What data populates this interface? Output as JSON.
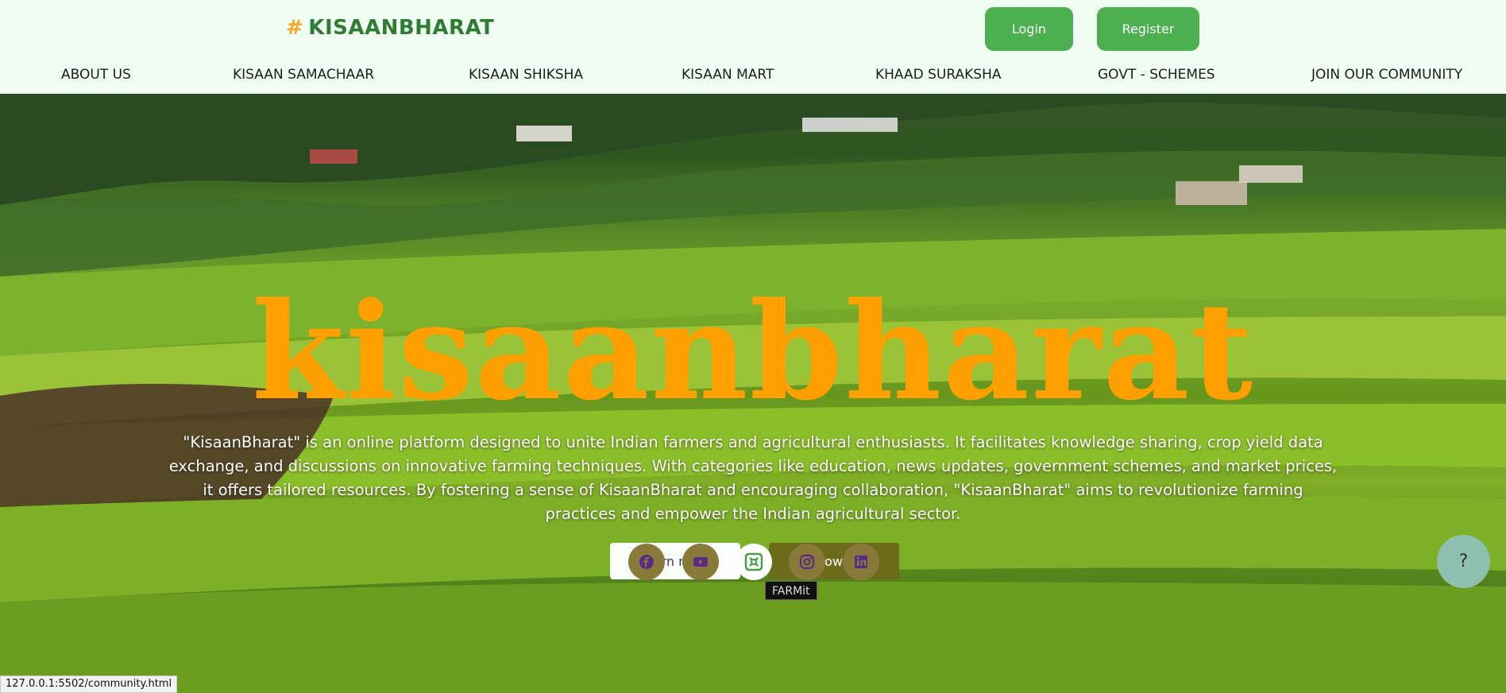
{
  "header": {
    "logo_hash": "#",
    "logo_text": "KISAANBHARAT",
    "login_label": "Login",
    "register_label": "Register"
  },
  "nav": {
    "items": [
      {
        "label": "ABOUT US"
      },
      {
        "label": "KISAAN SAMACHAAR"
      },
      {
        "label": "KISAAN SHIKSHA"
      },
      {
        "label": "KISAAN MART"
      },
      {
        "label": "KHAAD SURAKSHA"
      },
      {
        "label": "GOVT - SCHEMES"
      },
      {
        "label": "JOIN OUR COMMUNITY"
      }
    ]
  },
  "hero": {
    "title": "kisaanbharat",
    "description": "\"KisaanBharat\" is an online platform designed to unite Indian farmers and agricultural enthusiasts. It facilitates knowledge sharing, crop yield data exchange, and discussions on innovative farming techniques. With categories like education, news updates, government schemes, and market prices, it offers tailored resources. By fostering a sense of KisaanBharat and encouraging collaboration, \"KisaanBharat\" aims to revolutionize farming practices and empower the Indian agricultural sector.",
    "learn_more_label": "Learn more",
    "browse_label": "Browse"
  },
  "social": {
    "icons": [
      "facebook-icon",
      "youtube-icon",
      "farmit-icon",
      "instagram-icon",
      "linkedin-icon"
    ],
    "tooltip": "FARMit"
  },
  "help": {
    "label": "?"
  },
  "status_bar": {
    "url": "127.0.0.1:5502/community.html"
  },
  "colors": {
    "brand_green": "#4caf50",
    "logo_green": "#2e7d32",
    "logo_hash": "#f9a825",
    "hero_title": "#ffa000",
    "browse_bg": "#6b6b1a",
    "social_bg": "#8a7a3a",
    "help_bg": "#8fbfae"
  }
}
